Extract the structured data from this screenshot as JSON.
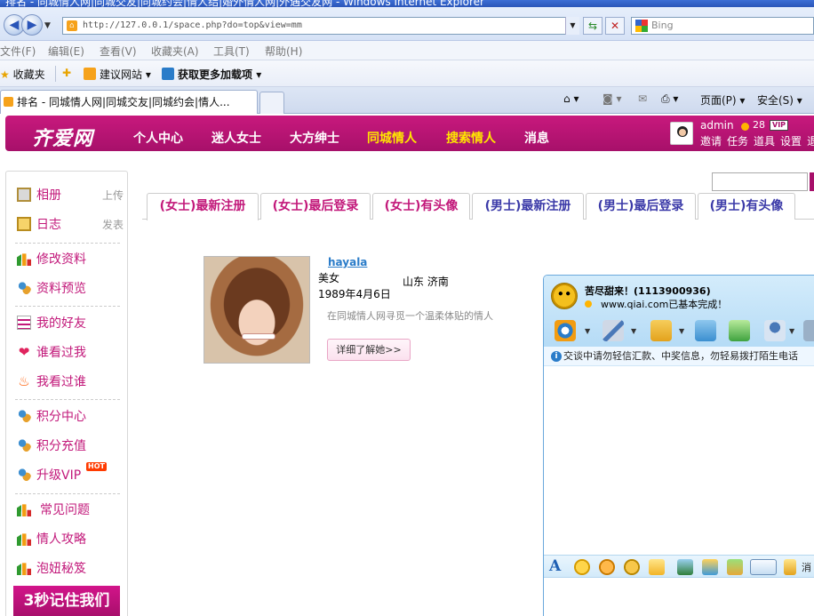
{
  "browser": {
    "title": "排名 - 同城情人网|同城交友|同城约会|情人结|婚外情人网|外遇交友网 - Windows Internet Explorer",
    "url": "http://127.0.0.1/space.php?do=top&view=mm",
    "search_placeholder": "Bing",
    "menu": [
      "文件(F)",
      "编辑(E)",
      "查看(V)",
      "收藏夹(A)",
      "工具(T)",
      "帮助(H)"
    ],
    "favorites_label": "收藏夹",
    "suggested_sites": "建议网站",
    "more_addons": "获取更多加载项",
    "tab_title": "排名 - 同城情人网|同城交友|同城约会|情人...",
    "page_menu": "页面(P)",
    "safety_menu": "安全(S)"
  },
  "site": {
    "logo": "齐爱网",
    "nav": [
      "个人中心",
      "迷人女士",
      "大方绅士",
      "同城情人",
      "搜索情人",
      "消息"
    ],
    "user": {
      "name": "admin",
      "coins": "28",
      "vip": "VIP",
      "links": [
        "邀请",
        "任务",
        "道具",
        "设置",
        "退"
      ]
    }
  },
  "sidebar": {
    "items": [
      {
        "label": "相册",
        "extra": "上传",
        "icon": "album-icon"
      },
      {
        "label": "日志",
        "extra": "发表",
        "icon": "diary-icon"
      },
      {
        "label": "修改资料",
        "icon": "chart-icon"
      },
      {
        "label": "资料预览",
        "icon": "people-icon"
      },
      {
        "label": "我的好友",
        "icon": "list-icon"
      },
      {
        "label": "谁看过我",
        "icon": "heart-icon"
      },
      {
        "label": "我看过谁",
        "icon": "fire-icon"
      },
      {
        "label": "积分中心",
        "icon": "people-icon"
      },
      {
        "label": "积分充值",
        "icon": "people-icon"
      },
      {
        "label": "升级VIP",
        "badge": "HOT",
        "icon": "people-icon"
      },
      {
        "label": "常见问题",
        "icon": "chart-icon"
      },
      {
        "label": "情人攻略",
        "icon": "chart-icon"
      },
      {
        "label": "泡妞秘笈",
        "icon": "chart-icon"
      }
    ],
    "banner": "3秒记住我们"
  },
  "tabs": [
    "(女士)最新注册",
    "(女士)最后登录",
    "(女士)有头像",
    "(男士)最新注册",
    "(男士)最后登录",
    "(男士)有头像"
  ],
  "profile": {
    "name": "hayala",
    "tag": "美女",
    "location": "山东  济南",
    "birthday": "1989年4月6日",
    "description": "在同城情人网寻觅一个温柔体贴的情人",
    "more_button": "详细了解她>>"
  },
  "qq": {
    "name": "苦尽甜来！(1113900936)",
    "status": "www.qiai.com已基本完成！",
    "warning": "交谈中请勿轻信汇款、中奖信息，勿轻易拨打陌生电话",
    "send_label": "消"
  }
}
